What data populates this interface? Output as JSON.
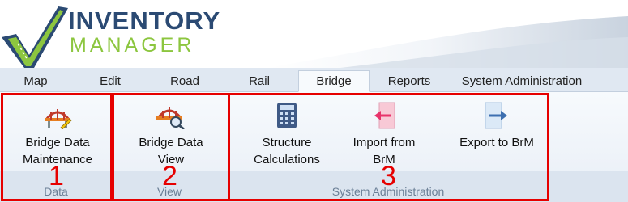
{
  "logo": {
    "line1": "INVENTORY",
    "line2": "MANAGER"
  },
  "tabs": [
    {
      "label": "Map"
    },
    {
      "label": "Edit"
    },
    {
      "label": "Road"
    },
    {
      "label": "Rail"
    },
    {
      "label": "Bridge",
      "active": true
    },
    {
      "label": "Reports"
    },
    {
      "label": "System Administration"
    }
  ],
  "ribbon": {
    "groups": [
      {
        "label": "Data",
        "number": "1"
      },
      {
        "label": "View",
        "number": "2"
      },
      {
        "label": "System Administration",
        "number": "3"
      }
    ],
    "buttons": {
      "bridge_data_maintenance": {
        "line1": "Bridge Data",
        "line2": "Maintenance",
        "icon": "bridge-edit-icon"
      },
      "bridge_data_view": {
        "line1": "Bridge Data",
        "line2": "View",
        "icon": "bridge-search-icon"
      },
      "structure_calculations": {
        "line1": "Structure",
        "line2": "Calculations",
        "icon": "calculator-icon"
      },
      "import_from_brm": {
        "line1": "Import from",
        "line2": "BrM",
        "icon": "import-icon"
      },
      "export_to_brm": {
        "line1": "Export to BrM",
        "icon": "export-icon"
      }
    }
  },
  "colors": {
    "annotation_red": "#e60000",
    "logo_blue": "#2b4a73",
    "logo_green": "#8cc63f"
  }
}
